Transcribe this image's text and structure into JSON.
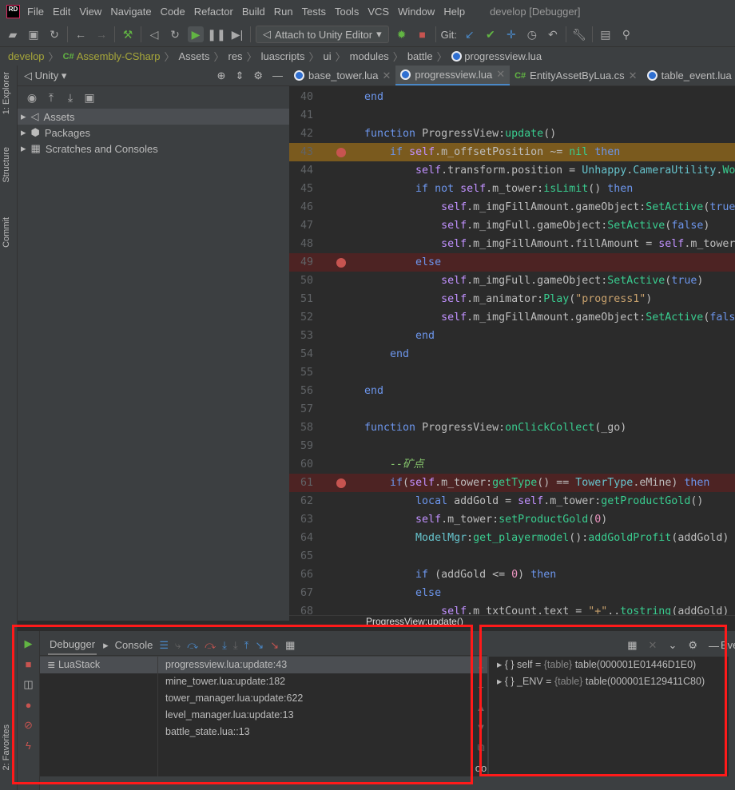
{
  "menubar": {
    "logo": "RD",
    "items": [
      "File",
      "Edit",
      "View",
      "Navigate",
      "Code",
      "Refactor",
      "Build",
      "Run",
      "Tests",
      "Tools",
      "VCS",
      "Window",
      "Help"
    ],
    "title": "develop [Debugger]"
  },
  "toolbar": {
    "attach_label": "Attach to Unity Editor",
    "git_label": "Git:"
  },
  "breadcrumb": [
    "develop",
    "Assembly-CSharp",
    "Assets",
    "res",
    "luascripts",
    "ui",
    "modules",
    "battle",
    "progressview.lua"
  ],
  "sidebar": {
    "explorer": "1: Explorer",
    "structure": "Structure",
    "commit": "Commit",
    "favorites": "2: Favorites"
  },
  "project": {
    "view": "Unity",
    "tree": [
      "Assets",
      "Packages",
      "Scratches and Consoles"
    ]
  },
  "tabs": [
    {
      "label": "base_tower.lua",
      "type": "lua"
    },
    {
      "label": "progressview.lua",
      "type": "lua",
      "active": true
    },
    {
      "label": "EntityAssetByLua.cs",
      "type": "cs"
    },
    {
      "label": "table_event.lua",
      "type": "lua"
    }
  ],
  "code": [
    {
      "n": 40,
      "t": [
        [
          "kw",
          "end"
        ]
      ]
    },
    {
      "n": 41,
      "t": []
    },
    {
      "n": 42,
      "t": [
        [
          "kw",
          "function "
        ],
        [
          "id",
          "ProgressView:"
        ],
        [
          "fn",
          "update"
        ],
        [
          "id",
          "()"
        ]
      ]
    },
    {
      "n": 43,
      "state": "current",
      "bp": true,
      "t": [
        [
          "id",
          "    "
        ],
        [
          "kw",
          "if "
        ],
        [
          "self",
          "self"
        ],
        [
          "id",
          ".m_offsetPosition ~= "
        ],
        [
          "fn",
          "nil "
        ],
        [
          "kw",
          "then"
        ]
      ]
    },
    {
      "n": 44,
      "t": [
        [
          "id",
          "        "
        ],
        [
          "self",
          "self"
        ],
        [
          "id",
          ".transform.position = "
        ],
        [
          "ty",
          "Unhappy"
        ],
        [
          "id",
          "."
        ],
        [
          "ty",
          "CameraUtility"
        ],
        [
          "id",
          "."
        ],
        [
          "fn",
          "WorldToUI"
        ]
      ]
    },
    {
      "n": 45,
      "t": [
        [
          "id",
          "        "
        ],
        [
          "kw",
          "if not "
        ],
        [
          "self",
          "self"
        ],
        [
          "id",
          ".m_tower:"
        ],
        [
          "fn",
          "isLimit"
        ],
        [
          "id",
          "() "
        ],
        [
          "kw",
          "then"
        ]
      ]
    },
    {
      "n": 46,
      "t": [
        [
          "id",
          "            "
        ],
        [
          "self",
          "self"
        ],
        [
          "id",
          ".m_imgFillAmount.gameObject:"
        ],
        [
          "fn",
          "SetActive"
        ],
        [
          "id",
          "("
        ],
        [
          "kw",
          "true"
        ],
        [
          "id",
          ")"
        ]
      ]
    },
    {
      "n": 47,
      "t": [
        [
          "id",
          "            "
        ],
        [
          "self",
          "self"
        ],
        [
          "id",
          ".m_imgFull.gameObject:"
        ],
        [
          "fn",
          "SetActive"
        ],
        [
          "id",
          "("
        ],
        [
          "kw",
          "false"
        ],
        [
          "id",
          ")"
        ]
      ]
    },
    {
      "n": 48,
      "t": [
        [
          "id",
          "            "
        ],
        [
          "self",
          "self"
        ],
        [
          "id",
          ".m_imgFillAmount.fillAmount = "
        ],
        [
          "self",
          "self"
        ],
        [
          "id",
          ".m_tower:getProgress()"
        ]
      ]
    },
    {
      "n": 49,
      "state": "breakpoint",
      "bp": true,
      "t": [
        [
          "id",
          "        "
        ],
        [
          "kw",
          "else"
        ]
      ]
    },
    {
      "n": 50,
      "t": [
        [
          "id",
          "            "
        ],
        [
          "self",
          "self"
        ],
        [
          "id",
          ".m_imgFull.gameObject:"
        ],
        [
          "fn",
          "SetActive"
        ],
        [
          "id",
          "("
        ],
        [
          "kw",
          "true"
        ],
        [
          "id",
          ")"
        ]
      ]
    },
    {
      "n": 51,
      "t": [
        [
          "id",
          "            "
        ],
        [
          "self",
          "self"
        ],
        [
          "id",
          ".m_animator:"
        ],
        [
          "fn",
          "Play"
        ],
        [
          "id",
          "("
        ],
        [
          "str",
          "\"progress1\""
        ],
        [
          "id",
          ")"
        ]
      ]
    },
    {
      "n": 52,
      "t": [
        [
          "id",
          "            "
        ],
        [
          "self",
          "self"
        ],
        [
          "id",
          ".m_imgFillAmount.gameObject:"
        ],
        [
          "fn",
          "SetActive"
        ],
        [
          "id",
          "("
        ],
        [
          "kw",
          "false"
        ],
        [
          "id",
          ")"
        ]
      ]
    },
    {
      "n": 53,
      "t": [
        [
          "id",
          "        "
        ],
        [
          "kw",
          "end"
        ]
      ]
    },
    {
      "n": 54,
      "t": [
        [
          "id",
          "    "
        ],
        [
          "kw",
          "end"
        ]
      ]
    },
    {
      "n": 55,
      "t": []
    },
    {
      "n": 56,
      "t": [
        [
          "kw",
          "end"
        ]
      ]
    },
    {
      "n": 57,
      "t": []
    },
    {
      "n": 58,
      "t": [
        [
          "kw",
          "function "
        ],
        [
          "id",
          "ProgressView:"
        ],
        [
          "fn",
          "onClickCollect"
        ],
        [
          "id",
          "(_go)"
        ]
      ]
    },
    {
      "n": 59,
      "t": []
    },
    {
      "n": 60,
      "t": [
        [
          "id",
          "    "
        ],
        [
          "cm",
          "--矿点"
        ]
      ]
    },
    {
      "n": 61,
      "state": "breakpoint",
      "bp": true,
      "t": [
        [
          "id",
          "    "
        ],
        [
          "kw",
          "if"
        ],
        [
          "id",
          "("
        ],
        [
          "self",
          "self"
        ],
        [
          "id",
          ".m_tower:"
        ],
        [
          "fn",
          "getType"
        ],
        [
          "id",
          "() == "
        ],
        [
          "ty",
          "TowerType"
        ],
        [
          "id",
          ".eMine) "
        ],
        [
          "kw",
          "then"
        ]
      ]
    },
    {
      "n": 62,
      "t": [
        [
          "id",
          "        "
        ],
        [
          "kw",
          "local "
        ],
        [
          "id",
          "addGold = "
        ],
        [
          "self",
          "self"
        ],
        [
          "id",
          ".m_tower:"
        ],
        [
          "fn",
          "getProductGold"
        ],
        [
          "id",
          "()"
        ]
      ]
    },
    {
      "n": 63,
      "t": [
        [
          "id",
          "        "
        ],
        [
          "self",
          "self"
        ],
        [
          "id",
          ".m_tower:"
        ],
        [
          "fn",
          "setProductGold"
        ],
        [
          "id",
          "("
        ],
        [
          "num",
          "0"
        ],
        [
          "id",
          ")"
        ]
      ]
    },
    {
      "n": 64,
      "t": [
        [
          "id",
          "        "
        ],
        [
          "ty",
          "ModelMgr"
        ],
        [
          "id",
          ":"
        ],
        [
          "fn",
          "get_playermodel"
        ],
        [
          "id",
          "():"
        ],
        [
          "fn",
          "addGoldProfit"
        ],
        [
          "id",
          "(addGold)"
        ]
      ]
    },
    {
      "n": 65,
      "t": []
    },
    {
      "n": 66,
      "t": [
        [
          "id",
          "        "
        ],
        [
          "kw",
          "if "
        ],
        [
          "id",
          "(addGold <= "
        ],
        [
          "num",
          "0"
        ],
        [
          "id",
          ") "
        ],
        [
          "kw",
          "then"
        ]
      ]
    },
    {
      "n": 67,
      "t": [
        [
          "id",
          "        "
        ],
        [
          "kw",
          "else"
        ]
      ]
    },
    {
      "n": 68,
      "t": [
        [
          "id",
          "            "
        ],
        [
          "self",
          "self"
        ],
        [
          "id",
          ".m_txtCount.text = "
        ],
        [
          "str",
          "\"+\""
        ],
        [
          "id",
          ".."
        ],
        [
          "fn",
          "tostring"
        ],
        [
          "id",
          "(addGold)"
        ]
      ]
    }
  ],
  "editor_hint": "ProgressView:update()",
  "debugger": {
    "tab_debugger": "Debugger",
    "tab_console": "Console",
    "thread": "LuaStack",
    "frames": [
      "progressview.lua:update:43",
      "mine_tower.lua:update:182",
      "tower_manager.lua:update:622",
      "level_manager.lua:update:13",
      "battle_state.lua::13"
    ],
    "variables": [
      {
        "name": "self",
        "type": "{table}",
        "value": "table(000001E01446D1E0)"
      },
      {
        "name": "_ENV",
        "type": "{table}",
        "value": "table(000001E129411C80)"
      }
    ],
    "side_label": "Eve"
  },
  "colors": {
    "current_line": "#7a5a1e",
    "breakpoint_line": "#4d2323",
    "breakpoint": "#c75450",
    "annotation": "#ff1a1a"
  }
}
